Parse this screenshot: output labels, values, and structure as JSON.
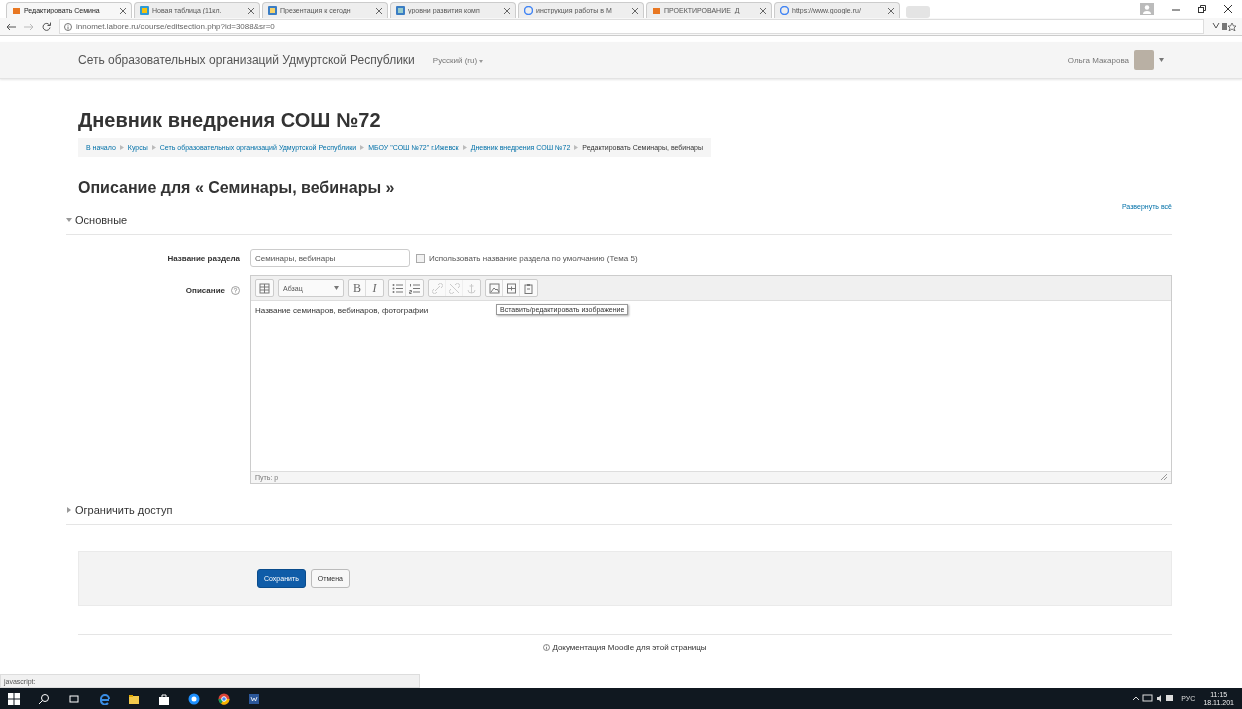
{
  "browser": {
    "tabs": [
      {
        "title": "Редактировать Семина",
        "selected": true
      },
      {
        "title": "Новая таблица (11кл.",
        "selected": false
      },
      {
        "title": "Презентация к сегодн",
        "selected": false
      },
      {
        "title": "уровни развития комп",
        "selected": false
      },
      {
        "title": "инструкция работы в М",
        "selected": false
      },
      {
        "title": "ПРОЕКТИРОВАНИЕ_Д",
        "selected": false
      },
      {
        "title": "https://www.google.ru/",
        "selected": false
      }
    ],
    "address": "innomet.labore.ru/course/editsection.php?id=3088&sr=0"
  },
  "navbar": {
    "site": "Сеть образовательных организаций Удмуртской Республики",
    "language": "Русский (ru)",
    "user": "Ольга Макарова"
  },
  "heading": "Дневник внедрения СОШ №72",
  "breadcrumb": [
    {
      "label": "В начало",
      "link": true
    },
    {
      "label": "Курсы",
      "link": true
    },
    {
      "label": "Сеть образовательных организаций Удмуртской Республики",
      "link": true
    },
    {
      "label": "МБОУ \"СОШ №72\" г.Ижевск",
      "link": true
    },
    {
      "label": "Дневник внедрения СОШ №72",
      "link": true
    },
    {
      "label": "Редактировать Семинары, вебинары",
      "link": false
    }
  ],
  "page_title": "Описание для « Семинары, вебинары »",
  "expand_all": "Развернуть всё",
  "sections": [
    {
      "title": "Основные",
      "expanded": true
    },
    {
      "title": "Ограничить доступ",
      "expanded": false
    }
  ],
  "form": {
    "name_label": "Название раздела",
    "name_value": "Семинары, вебинары",
    "default_checkbox": {
      "label": "Использовать название раздела по умолчанию (Тема 5)",
      "checked": false
    },
    "description_label": "Описание",
    "toolbar": [
      [
        {
          "kind": "toggle"
        }
      ],
      [
        {
          "kind": "select",
          "label": "Абзац"
        }
      ],
      [
        {
          "kind": "bold",
          "label": "B"
        },
        {
          "kind": "italic",
          "label": "I"
        }
      ],
      [
        {
          "kind": "bullets"
        },
        {
          "kind": "numbers"
        }
      ],
      [
        {
          "kind": "link",
          "disabled": true
        },
        {
          "kind": "unlink",
          "disabled": true
        },
        {
          "kind": "anchor",
          "disabled": true
        }
      ],
      [
        {
          "kind": "image"
        },
        {
          "kind": "media"
        },
        {
          "kind": "paste"
        }
      ]
    ],
    "editor_text": "Название семинаров, вебинаров, фотографии",
    "tooltip": "Вставить/редактировать изображение",
    "path": "Путь: p"
  },
  "buttons": [
    {
      "label": "Сохранить",
      "primary": true
    },
    {
      "label": "Отмена",
      "primary": false
    }
  ],
  "footer_link": "Документация Moodle для этой страницы",
  "status_text": "javascript:",
  "taskbar": {
    "language": "РУС",
    "time": "11:15",
    "date": "18.11.201"
  }
}
